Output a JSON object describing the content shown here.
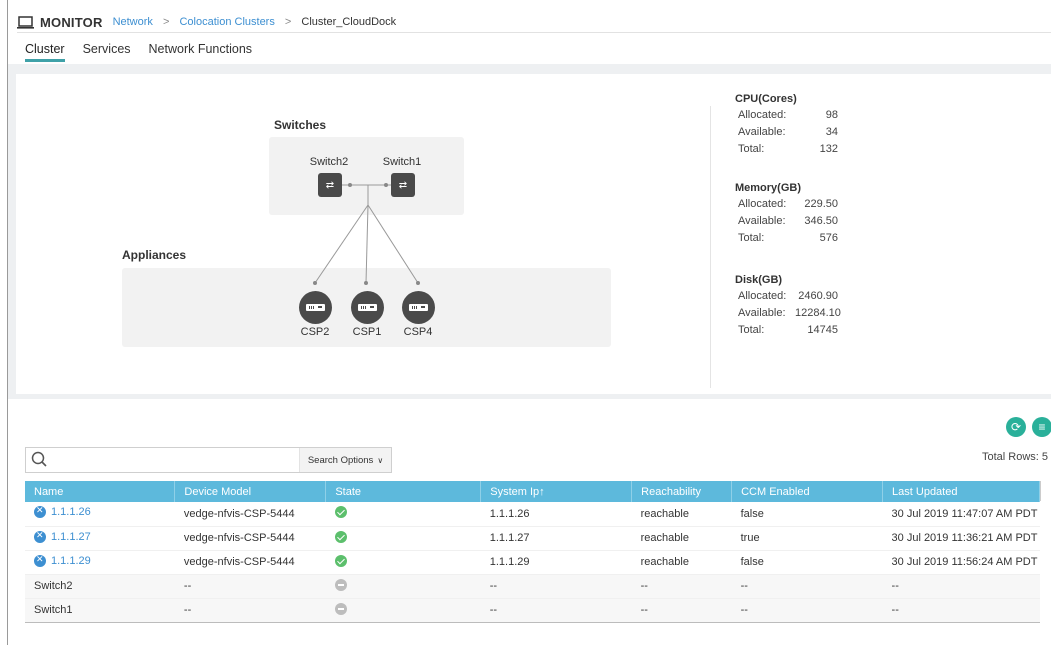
{
  "header": {
    "title": "MONITOR",
    "breadcrumb": [
      "Network",
      "Colocation Clusters",
      "Cluster_CloudDock"
    ],
    "separator": ">"
  },
  "tabs": [
    {
      "label": "Cluster",
      "active": true
    },
    {
      "label": "Services",
      "active": false
    },
    {
      "label": "Network Functions",
      "active": false
    }
  ],
  "topology": {
    "switches_label": "Switches",
    "appliances_label": "Appliances",
    "switches": [
      "Switch2",
      "Switch1"
    ],
    "appliances": [
      "CSP2",
      "CSP1",
      "CSP4"
    ]
  },
  "resources": {
    "cpu": {
      "title": "CPU(Cores)",
      "allocated": "98",
      "available": "34",
      "total": "132"
    },
    "memory": {
      "title": "Memory(GB)",
      "allocated": "229.50",
      "available": "346.50",
      "total": "576"
    },
    "disk": {
      "title": "Disk(GB)",
      "allocated": "2460.90",
      "available": "12284.10",
      "total": "14745"
    },
    "labels": {
      "allocated": "Allocated:",
      "available": "Available:",
      "total": "Total:"
    }
  },
  "toolbar": {
    "total_rows": "Total Rows: 5",
    "search_placeholder": "",
    "search_options": "Search Options",
    "refresh_icon": "refresh-icon",
    "menu_icon": "menu-icon"
  },
  "table": {
    "columns": [
      "Name",
      "Device Model",
      "State",
      "System Ip↑",
      "Reachability",
      "CCM Enabled",
      "Last Updated"
    ],
    "rows": [
      {
        "name": "1.1.1.26",
        "model": "vedge-nfvis-CSP-5444",
        "state": "ok",
        "system_ip": "1.1.1.26",
        "reachability": "reachable",
        "ccm": "false",
        "updated": "30 Jul 2019 11:47:07 AM PDT"
      },
      {
        "name": "1.1.1.27",
        "model": "vedge-nfvis-CSP-5444",
        "state": "ok",
        "system_ip": "1.1.1.27",
        "reachability": "reachable",
        "ccm": "true",
        "updated": "30 Jul 2019 11:36:21 AM PDT"
      },
      {
        "name": "1.1.1.29",
        "model": "vedge-nfvis-CSP-5444",
        "state": "ok",
        "system_ip": "1.1.1.29",
        "reachability": "reachable",
        "ccm": "false",
        "updated": "30 Jul 2019 11:56:24 AM PDT"
      },
      {
        "name": "Switch2",
        "model": "--",
        "state": "na",
        "system_ip": "--",
        "reachability": "--",
        "ccm": "--",
        "updated": "--"
      },
      {
        "name": "Switch1",
        "model": "--",
        "state": "na",
        "system_ip": "--",
        "reachability": "--",
        "ccm": "--",
        "updated": "--"
      }
    ]
  },
  "colors": {
    "accent": "#3fa1a8",
    "table_header": "#5db9dc",
    "link": "#3d8fd1",
    "ok": "#5cbf6c",
    "action": "#2ab09a"
  }
}
